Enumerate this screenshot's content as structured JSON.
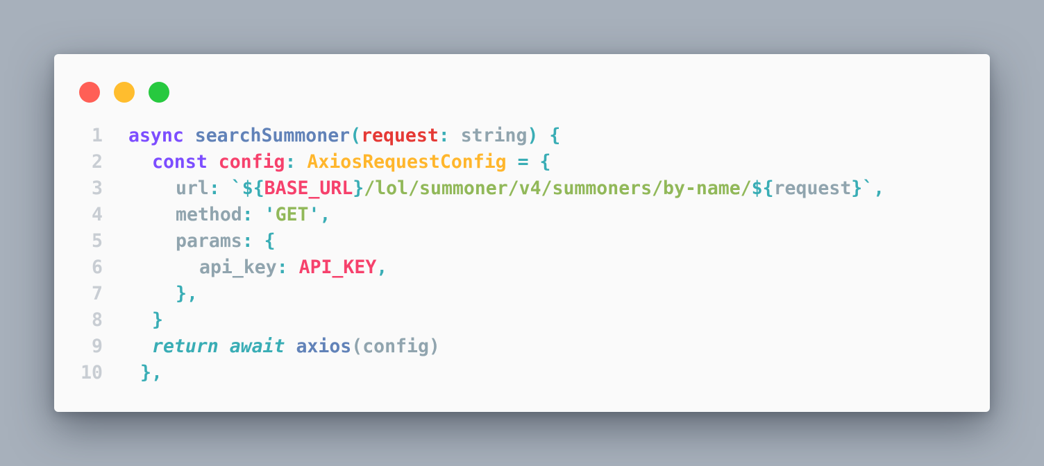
{
  "window": {
    "controls": [
      {
        "name": "close-button",
        "color": "#ff5f56"
      },
      {
        "name": "minimize-button",
        "color": "#ffbd2e"
      },
      {
        "name": "maximize-button",
        "color": "#27c93f"
      }
    ]
  },
  "colors": {
    "keyword": "#7c4dff",
    "function": "#6182b8",
    "param": "#e53935",
    "plain": "#90a4ae",
    "punct": "#39adb5",
    "type": "#ffb62c",
    "variable": "#f6416c",
    "string": "#91b859",
    "line_number": "#c8cdd3"
  },
  "code": {
    "lines": [
      {
        "n": "1",
        "indent": 0,
        "tokens": [
          {
            "t": "async",
            "c": "keyword"
          },
          {
            "t": " ",
            "c": "plain"
          },
          {
            "t": "searchSummoner",
            "c": "function"
          },
          {
            "t": "(",
            "c": "punct"
          },
          {
            "t": "request",
            "c": "param"
          },
          {
            "t": ":",
            "c": "punct"
          },
          {
            "t": " string",
            "c": "plain"
          },
          {
            "t": ")",
            "c": "punct"
          },
          {
            "t": " {",
            "c": "punct"
          }
        ]
      },
      {
        "n": "2",
        "indent": 1,
        "tokens": [
          {
            "t": "const",
            "c": "keyword"
          },
          {
            "t": " ",
            "c": "plain"
          },
          {
            "t": "config",
            "c": "variable"
          },
          {
            "t": ":",
            "c": "punct"
          },
          {
            "t": " ",
            "c": "plain"
          },
          {
            "t": "AxiosRequestConfig",
            "c": "type"
          },
          {
            "t": " = {",
            "c": "punct"
          }
        ]
      },
      {
        "n": "3",
        "indent": 2,
        "tokens": [
          {
            "t": "url",
            "c": "plain"
          },
          {
            "t": ": `${",
            "c": "punct"
          },
          {
            "t": "BASE_URL",
            "c": "variable"
          },
          {
            "t": "}",
            "c": "punct"
          },
          {
            "t": "/lol/summoner/v4/summoners/by-name/",
            "c": "string"
          },
          {
            "t": "${",
            "c": "punct"
          },
          {
            "t": "request",
            "c": "plain"
          },
          {
            "t": "}`,",
            "c": "punct"
          }
        ]
      },
      {
        "n": "4",
        "indent": 2,
        "tokens": [
          {
            "t": "method",
            "c": "plain"
          },
          {
            "t": ": '",
            "c": "punct"
          },
          {
            "t": "GET",
            "c": "string"
          },
          {
            "t": "',",
            "c": "punct"
          }
        ]
      },
      {
        "n": "5",
        "indent": 2,
        "tokens": [
          {
            "t": "params",
            "c": "plain"
          },
          {
            "t": ": {",
            "c": "punct"
          }
        ]
      },
      {
        "n": "6",
        "indent": 3,
        "tokens": [
          {
            "t": "api_key",
            "c": "plain"
          },
          {
            "t": ": ",
            "c": "punct"
          },
          {
            "t": "API_KEY",
            "c": "variable"
          },
          {
            "t": ",",
            "c": "punct"
          }
        ]
      },
      {
        "n": "7",
        "indent": 2,
        "tokens": [
          {
            "t": "},",
            "c": "punct"
          }
        ]
      },
      {
        "n": "8",
        "indent": 1,
        "tokens": [
          {
            "t": "}",
            "c": "punct"
          }
        ]
      },
      {
        "n": "9",
        "indent": 1,
        "tokens": [
          {
            "t": "return",
            "c": "punct",
            "italic": true
          },
          {
            "t": " ",
            "c": "plain"
          },
          {
            "t": "await",
            "c": "punct",
            "italic": true
          },
          {
            "t": " ",
            "c": "plain"
          },
          {
            "t": "axios",
            "c": "function"
          },
          {
            "t": "(config)",
            "c": "plain"
          }
        ]
      },
      {
        "n": "10",
        "indent": 0.5,
        "tokens": [
          {
            "t": "},",
            "c": "punct"
          }
        ]
      }
    ]
  }
}
